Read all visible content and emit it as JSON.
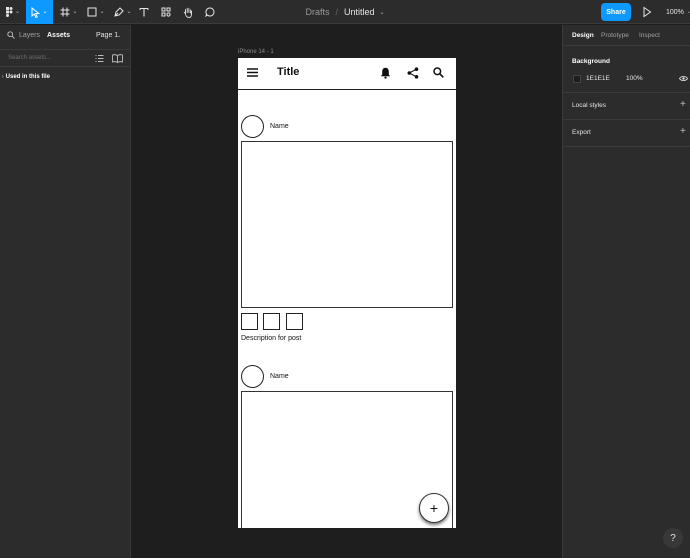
{
  "toolbar": {
    "tools": [
      "main-menu",
      "move",
      "frame",
      "shape",
      "pen",
      "text",
      "resources",
      "hand",
      "comment"
    ],
    "breadcrumb": {
      "folder": "Drafts",
      "separator": "/",
      "file": "Untitled"
    },
    "share_label": "Share",
    "zoom": "100%",
    "accent": "#0d99ff"
  },
  "left_panel": {
    "tabs": {
      "layers": "Layers",
      "assets": "Assets",
      "page": "Page 1"
    },
    "search_placeholder": "Search assets...",
    "section": "Used in this file"
  },
  "right_panel": {
    "tabs": {
      "design": "Design",
      "prototype": "Prototype",
      "inspect": "Inspect"
    },
    "background": {
      "title": "Background",
      "hex": "1E1E1E",
      "opacity": "100%",
      "color": "#1e1e1e"
    },
    "local_styles": "Local styles",
    "export": "Export"
  },
  "canvas": {
    "frame_label": "iPhone 14 - 1",
    "app": {
      "title": "Title",
      "posts": [
        {
          "name": "Name",
          "description": "Description for post"
        },
        {
          "name": "Name"
        }
      ],
      "fab": "+"
    }
  },
  "help": "?"
}
